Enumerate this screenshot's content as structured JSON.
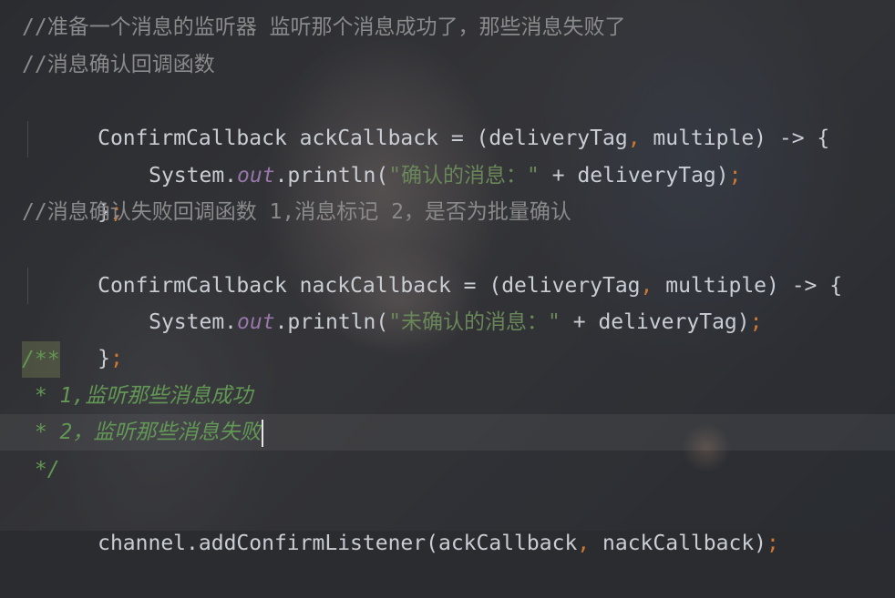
{
  "lines": [
    {
      "text": "//准备一个消息的监听器 监听那个消息成功了，那些消息失败了"
    },
    {
      "text": "//消息确认回调函数"
    },
    {
      "head": "ConfirmCallback ackCallback = ",
      "params": "(deliveryTag",
      "sep": ",",
      "tail": " multiple) -> ",
      "brace": "{"
    },
    {
      "obj": "System.",
      "field": "out",
      "call": ".println(",
      "str": "\"确认的消息：\"",
      "rest": " + deliveryTag)",
      "semi": ";"
    },
    {
      "close": "}",
      "semi": ";"
    },
    {
      "text": "//消息确认失败回调函数 1,消息标记 2，是否为批量确认"
    },
    {
      "head": "ConfirmCallback nackCallback = ",
      "params": "(deliveryTag",
      "sep": ",",
      "tail": " multiple) -> ",
      "brace": "{"
    },
    {
      "obj": "System.",
      "field": "out",
      "call": ".println(",
      "str": "\"未确认的消息：\"",
      "rest": " + deliveryTag)",
      "semi": ";"
    },
    {
      "close": "}",
      "semi": ";"
    },
    {
      "text": "/**"
    },
    {
      "text": " * 1,监听那些消息成功"
    },
    {
      "text": " * 2，监听那些消息失败"
    },
    {
      "text": " */"
    },
    {
      "head": "channel.addConfirmListener(ackCallback",
      "sep": ",",
      "tail": " nackCallback)",
      "semi": ";"
    }
  ],
  "colors": {
    "comment": "#8a8a8a",
    "doc_comment": "#629755",
    "keyword_punct": "#cc7832",
    "static_field": "#9876aa",
    "string": "#6a8759",
    "text": "#c9cdd4"
  }
}
